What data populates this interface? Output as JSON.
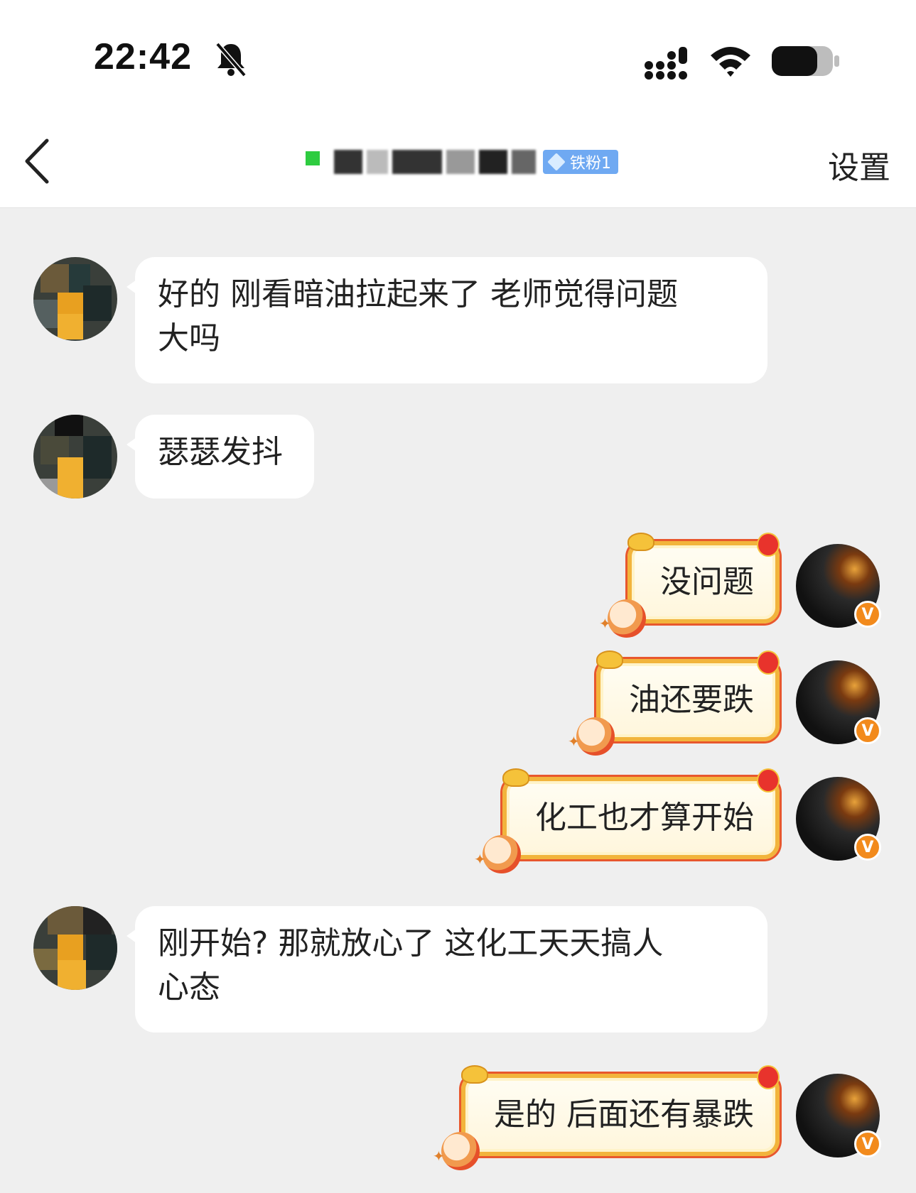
{
  "status_bar": {
    "time": "22:42"
  },
  "nav": {
    "fan_badge": "铁粉1",
    "settings_label": "设置"
  },
  "messages": [
    {
      "side": "left",
      "lines": [
        "好的  刚看暗油拉起来了  老师觉得问题",
        "大吗"
      ]
    },
    {
      "side": "left",
      "lines": [
        "瑟瑟发抖"
      ]
    },
    {
      "side": "right",
      "text": "没问题"
    },
    {
      "side": "right",
      "text": "油还要跌"
    },
    {
      "side": "right",
      "text": "化工也才算开始"
    },
    {
      "side": "left",
      "lines": [
        "刚开始?   那就放心了  这化工天天搞人",
        "心态"
      ]
    },
    {
      "side": "right",
      "text": "是的 后面还有暴跌"
    }
  ],
  "verified_badge": "V",
  "colors": {
    "online": "#2ecc40",
    "fan_badge_bg": "#6fa9f2",
    "bubble_border": "#f2b43c",
    "verified": "#f28a1c"
  }
}
